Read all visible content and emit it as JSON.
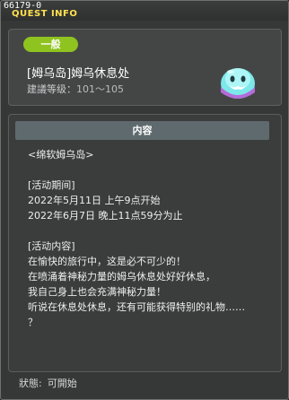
{
  "window": {
    "id_text": "66179-0",
    "title": "QUEST INFO"
  },
  "header": {
    "badge": "一般",
    "quest_name": "[姆乌岛]姆乌休息处",
    "level_label": "建議等级：",
    "level_range": "101～105",
    "npc_icon": "ghost-npc-icon"
  },
  "content": {
    "header": "内容",
    "lines": [
      "<绵软姆乌岛>",
      "",
      "[活动期间]",
      "2022年5月11日 上午9点开始",
      "2022年6月7日 晚上11点59分为止",
      "",
      "[活动内容]",
      "在愉快的旅行中，这是必不可少的！",
      "在喷涌着神秘力量的姆乌休息处好好休息，",
      "我自己身上也会充满神秘力量！",
      "听说在休息处休息，还有可能获得特别的礼物……",
      "？"
    ]
  },
  "status": {
    "label": "狀態:",
    "value": "可開始"
  },
  "colors": {
    "accent_title": "#ffe14d",
    "badge_green": "#8fc31f",
    "panel_header": "#5f6a6e",
    "npc_cyan": "#74e6e9"
  }
}
